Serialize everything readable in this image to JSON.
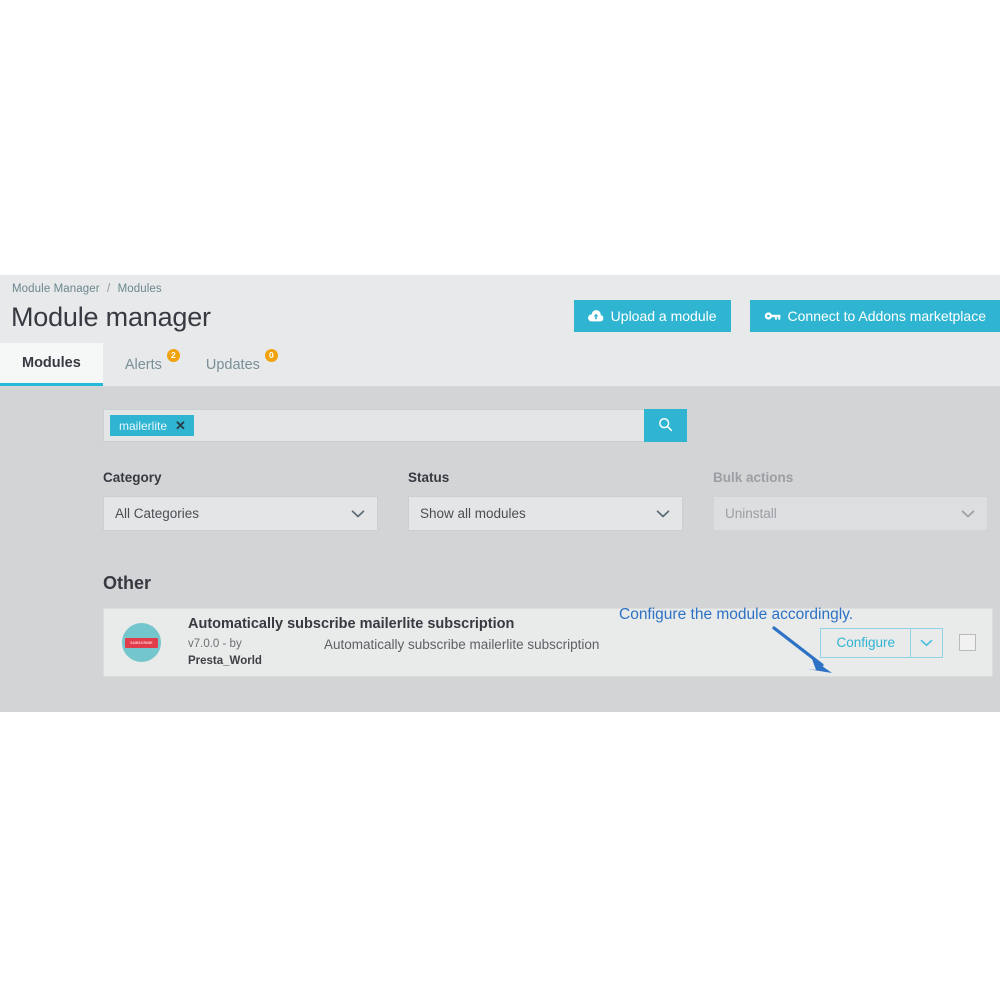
{
  "header": {
    "breadcrumb": {
      "parent": "Module Manager",
      "separator": "/",
      "current": "Modules"
    },
    "title": "Module manager",
    "actions": [
      {
        "label": "Upload a module",
        "icon": "cloud-upload-icon"
      },
      {
        "label": "Connect to Addons marketplace",
        "icon": "key-icon"
      }
    ],
    "accent_color": "#2fb5d2"
  },
  "tabs": [
    {
      "label": "Modules",
      "badge": null,
      "active": true
    },
    {
      "label": "Alerts",
      "badge": "2",
      "active": false
    },
    {
      "label": "Updates",
      "badge": "0",
      "active": false
    }
  ],
  "search": {
    "chip_label": "mailerlite",
    "chip_remove": "✕",
    "placeholder": "",
    "search_icon": "search-icon"
  },
  "filters": [
    {
      "label": "Category",
      "value": "All Categories",
      "disabled": false
    },
    {
      "label": "Status",
      "value": "Show all modules",
      "disabled": false
    },
    {
      "label": "Bulk actions",
      "value": "Uninstall",
      "disabled": true
    }
  ],
  "section": {
    "title": "Other"
  },
  "module": {
    "logo_text": "SUBSCRIBE",
    "name": "Automatically subscribe mailerlite subscription",
    "version": "v7.0.0 - by",
    "author": "Presta_World",
    "description": "Automatically subscribe mailerlite subscription",
    "configure_label": "Configure",
    "caret_icon": "chevron-down-icon",
    "checkbox": "unchecked"
  },
  "annotation": {
    "text": "Configure the module accordingly.",
    "color": "#2d72c4",
    "arrow": "arrow-pointing-to-configure"
  }
}
